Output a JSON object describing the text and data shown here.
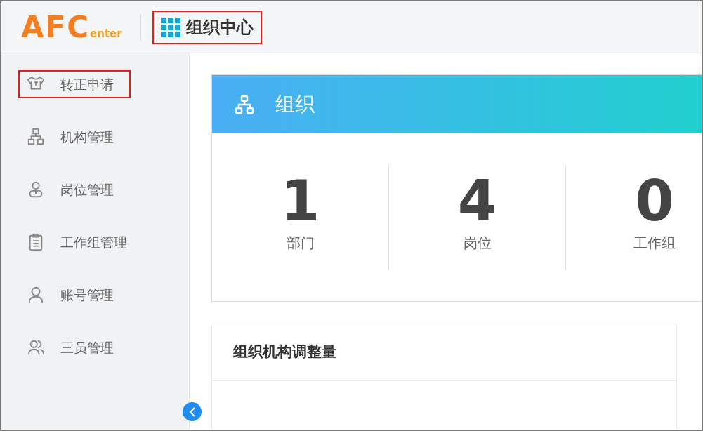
{
  "header": {
    "logo_main": "AFC",
    "logo_sub": "enter",
    "title": "组织中心",
    "title_highlighted": true
  },
  "sidebar": {
    "items": [
      {
        "label": "转正申请",
        "highlighted": true
      },
      {
        "label": "机构管理",
        "highlighted": false
      },
      {
        "label": "岗位管理",
        "highlighted": false
      },
      {
        "label": "工作组管理",
        "highlighted": false
      },
      {
        "label": "账号管理",
        "highlighted": false
      },
      {
        "label": "三员管理",
        "highlighted": false
      }
    ]
  },
  "banner": {
    "title": "组织"
  },
  "stats": [
    {
      "value": "1",
      "label": "部门"
    },
    {
      "value": "4",
      "label": "岗位"
    },
    {
      "value": "0",
      "label": "工作组"
    }
  ],
  "panel": {
    "title": "组织机构调整量"
  }
}
